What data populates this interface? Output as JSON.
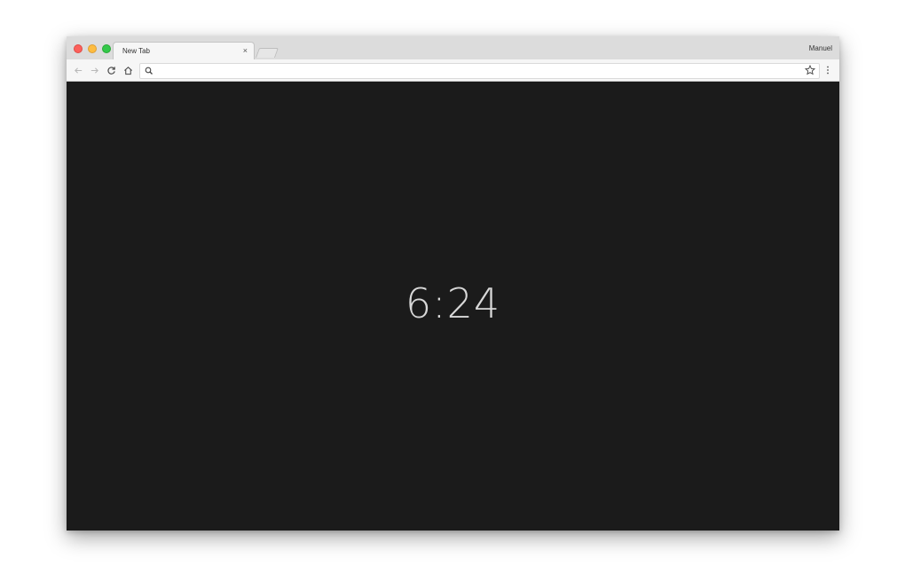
{
  "window": {
    "profile_name": "Manuel"
  },
  "tabs": [
    {
      "title": "New Tab",
      "close_glyph": "×"
    }
  ],
  "toolbar": {
    "back_icon": "back-arrow-icon",
    "forward_icon": "forward-arrow-icon",
    "reload_icon": "reload-icon",
    "home_icon": "home-icon",
    "star_icon": "star-icon",
    "menu_icon": "kebab-menu-icon"
  },
  "omnibox": {
    "value": "",
    "placeholder": ""
  },
  "content": {
    "clock_time": "6:24",
    "background_color": "#1b1b1b",
    "clock_color": "#d8d8d8"
  },
  "colors": {
    "close_light": "#fc605b",
    "minimize_light": "#fdbc40",
    "maximize_light": "#34c84a"
  }
}
